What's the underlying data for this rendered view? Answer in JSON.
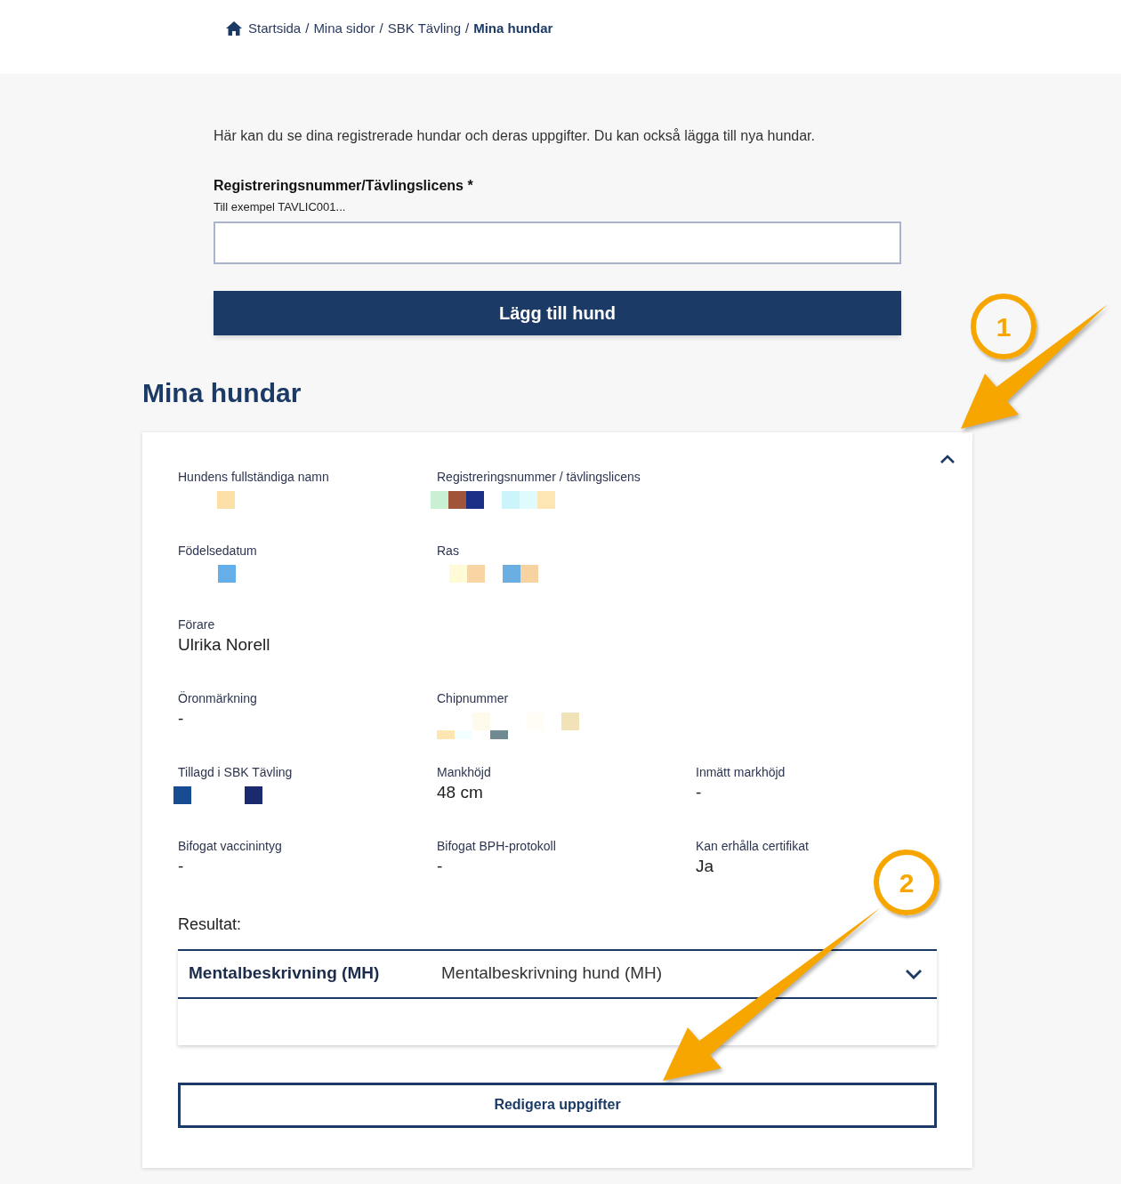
{
  "breadcrumb": [
    {
      "label": "Startsida",
      "separator": "/",
      "current": false
    },
    {
      "label": "Mina sidor",
      "separator": "/",
      "current": false
    },
    {
      "label": "SBK Tävling",
      "separator": "/",
      "current": false
    },
    {
      "label": "Mina hundar",
      "current": true
    }
  ],
  "intro": "Här kan du se dina registrerade hundar och deras uppgifter. Du kan också lägga till nya hundar.",
  "form": {
    "label": "Registreringsnummer/Tävlingslicens *",
    "hint": "Till exempel TAVLIC001...",
    "button": "Lägg till hund"
  },
  "section_title": "Mina hundar",
  "dog_card": {
    "expanded": true,
    "rows": [
      [
        {
          "label": "Hundens fullständiga namn",
          "kind": "redacted"
        },
        {
          "label": "Registreringsnummer / tävlingslicens",
          "kind": "redacted"
        }
      ],
      [
        {
          "label": "Födelsedatum",
          "kind": "redacted"
        },
        {
          "label": "Ras",
          "kind": "redacted"
        }
      ],
      [
        {
          "label": "Förare",
          "kind": "text",
          "value": "Ulrika Norell"
        }
      ],
      [
        {
          "label": "Öronmärkning",
          "kind": "text",
          "value": "-"
        },
        {
          "label": "Chipnummer",
          "kind": "redacted"
        }
      ],
      [
        {
          "label": "Tillagd i SBK Tävling",
          "kind": "redacted"
        },
        {
          "label": "Mankhöjd",
          "kind": "text",
          "value": "48 cm"
        },
        {
          "label": "Inmätt markhöjd",
          "kind": "text",
          "value": "-"
        }
      ],
      [
        {
          "label": "Bifogat vaccinintyg",
          "kind": "text",
          "value": "-"
        },
        {
          "label": "Bifogat BPH-protokoll",
          "kind": "text",
          "value": "-"
        },
        {
          "label": "Kan erhålla certifikat",
          "kind": "text",
          "value": "Ja"
        }
      ]
    ],
    "results_label": "Resultat:",
    "results": [
      {
        "category": "Mentalbeskrivning (MH)",
        "name": "Mentalbeskrivning hund (MH)",
        "expanded": false
      }
    ],
    "edit_button": "Redigera uppgifter"
  },
  "annotations": [
    {
      "number": "1"
    },
    {
      "number": "2"
    }
  ]
}
